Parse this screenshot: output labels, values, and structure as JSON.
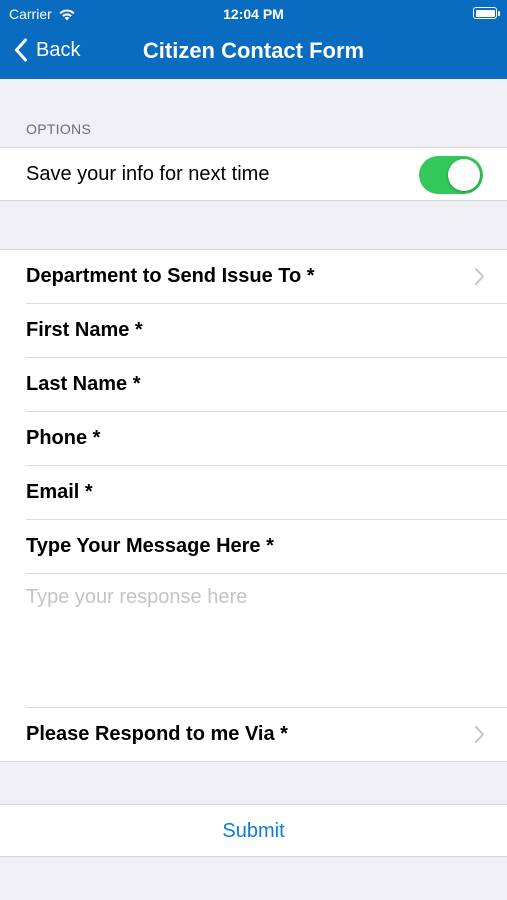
{
  "status_bar": {
    "carrier": "Carrier",
    "time": "12:04 PM"
  },
  "nav": {
    "back_label": "Back",
    "title": "Citizen Contact Form"
  },
  "options": {
    "header": "OPTIONS",
    "save_info_label": "Save your info for next time",
    "save_info_enabled": true
  },
  "form": {
    "department_label": "Department to Send Issue To *",
    "first_name_label": "First Name *",
    "last_name_label": "Last Name *",
    "phone_label": "Phone *",
    "email_label": "Email *",
    "message_label": "Type Your Message Here *",
    "message_placeholder": "Type your response here",
    "message_value": "",
    "respond_via_label": "Please Respond to me Via *"
  },
  "submit_label": "Submit",
  "colors": {
    "header_bg": "#0a6cc0",
    "toggle_on": "#34c759",
    "link": "#0a7be0"
  }
}
